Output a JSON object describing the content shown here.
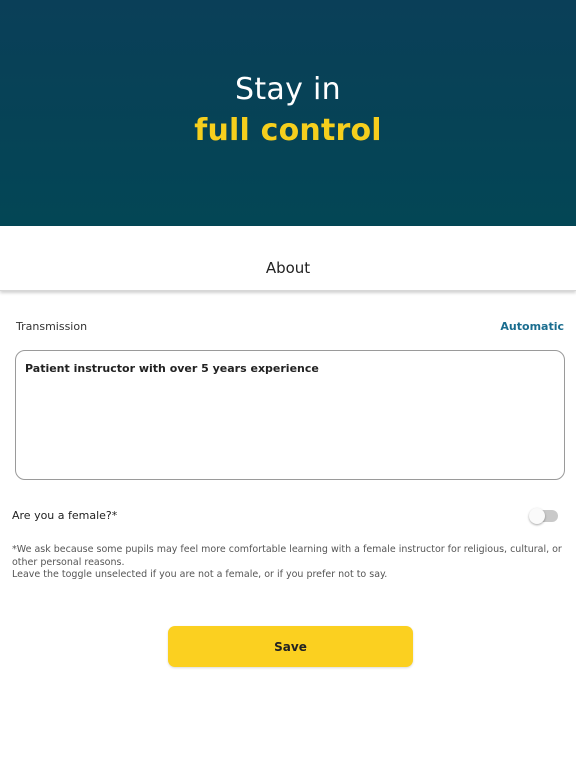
{
  "hero": {
    "line1": "Stay in",
    "line2": "full control"
  },
  "header": {
    "title": "About"
  },
  "transmission": {
    "label": "Transmission",
    "value": "Automatic"
  },
  "bio": {
    "value": "Patient instructor with over 5 years experience"
  },
  "female_question": {
    "label": "Are you a female?*",
    "toggle_on": false
  },
  "note": {
    "line1": "*We ask because some pupils may feel more comfortable learning with a female instructor for religious, cultural, or other personal reasons.",
    "line2": "Leave the toggle unselected if you are not a female, or if you prefer not to say."
  },
  "save_button": {
    "label": "Save"
  },
  "colors": {
    "hero_bg": "#034655",
    "accent_yellow": "#f6cf1d",
    "link_blue": "#1a6d8f",
    "button_yellow": "#fbd020"
  }
}
